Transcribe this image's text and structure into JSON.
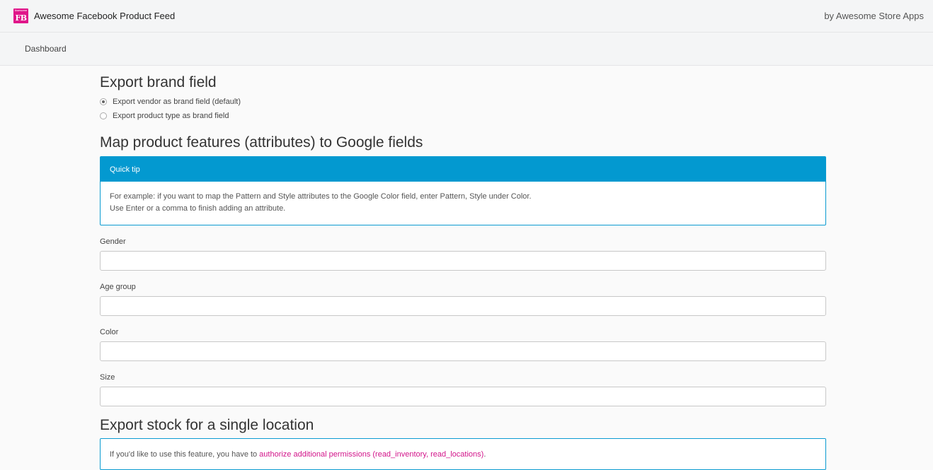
{
  "header": {
    "logo_small": "Awesome",
    "logo_big": "FB",
    "app_title": "Awesome Facebook Product Feed",
    "byline": "by Awesome Store Apps"
  },
  "nav": {
    "dashboard": "Dashboard"
  },
  "brand_section": {
    "title": "Export brand field",
    "options": [
      {
        "label": "Export vendor as brand field (default)",
        "checked": true
      },
      {
        "label": "Export product type as brand field",
        "checked": false
      }
    ]
  },
  "map_section": {
    "title": "Map product features (attributes) to Google fields",
    "tip_title": "Quick tip",
    "tip_line1": "For example: if you want to map the Pattern and Style attributes to the Google Color field, enter Pattern, Style under Color.",
    "tip_line2": "Use Enter or a comma to finish adding an attribute.",
    "fields": [
      {
        "label": "Gender",
        "value": ""
      },
      {
        "label": "Age group",
        "value": ""
      },
      {
        "label": "Color",
        "value": ""
      },
      {
        "label": "Size",
        "value": ""
      }
    ]
  },
  "stock_section": {
    "title": "Export stock for a single location",
    "notice_text": "If you'd like to use this feature, you have to",
    "notice_link": "authorize additional permissions (read_inventory, read_locations)",
    "notice_end": "."
  },
  "colors": {
    "accent": "#0399d0",
    "link": "#d2148a",
    "logo": "#e0168a"
  }
}
